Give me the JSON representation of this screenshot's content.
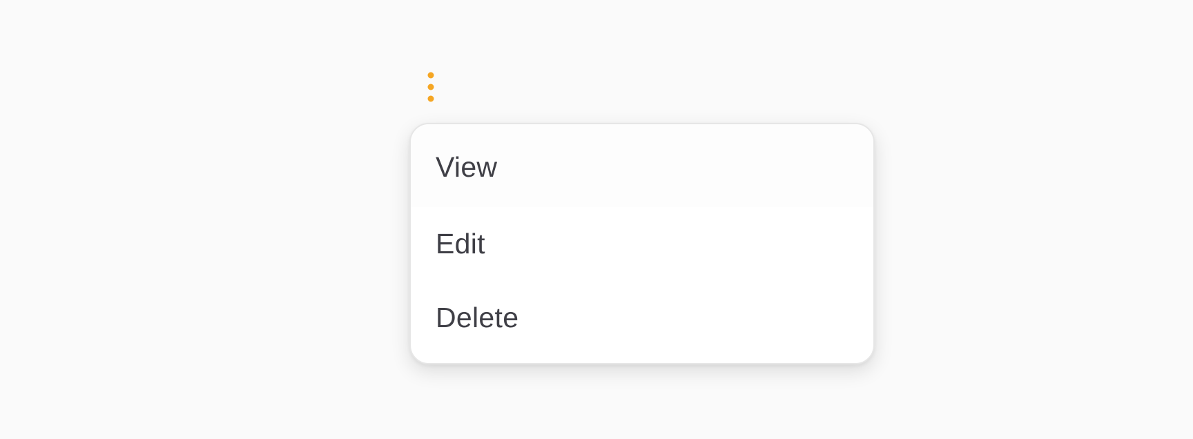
{
  "trigger": {
    "icon": "more-vertical-icon",
    "color": "#F5A623"
  },
  "menu": {
    "items": [
      {
        "label": "View"
      },
      {
        "label": "Edit"
      },
      {
        "label": "Delete"
      }
    ]
  },
  "colors": {
    "background": "#FAFAFA",
    "menu_background": "#FFFFFF",
    "menu_border": "#E6E6E6",
    "text": "#3F3F46"
  }
}
